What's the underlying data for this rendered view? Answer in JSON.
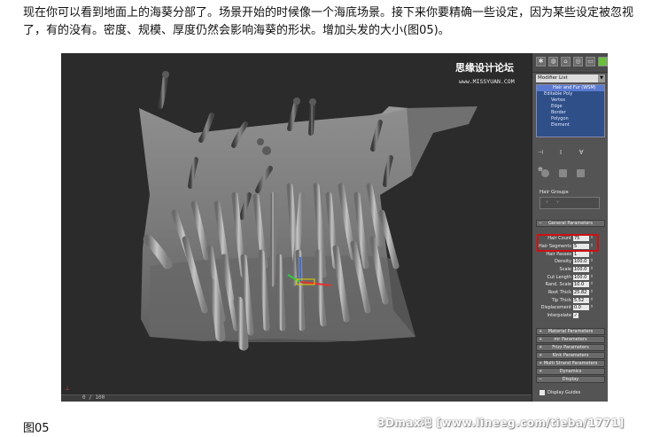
{
  "article": {
    "intro": "现在你可以看到地面上的海葵分部了。场景开始的时候像一个海底场景。接下来你要精确一些设定，因为某些设定被忽视了，有的没有。密度、规模、厚度仍然会影响海葵的形状。增加头发的大小(图05)。",
    "caption": "图05",
    "watermark_bottom": "3Dmax吧  [www.lineeg.com/tieba/1771]"
  },
  "screenshot": {
    "watermark_top": "思缘设计论坛",
    "watermark_top_url": "www.MISSYUAN.COM",
    "timebar_frame": "0 / 100",
    "modifier_list_label": "Modifier List",
    "modifier_stack": {
      "top": "Hair and Fur (WSM)",
      "base": "Editable Poly",
      "subobjects": [
        "Vertex",
        "Edge",
        "Border",
        "Polygon",
        "Element"
      ]
    },
    "hair_groups_label": "Hair Groups",
    "rollouts_top": [
      "General Parameters"
    ],
    "general_parameters": [
      {
        "label": "Hair Count",
        "value": "75"
      },
      {
        "label": "Hair Segments",
        "value": "5"
      },
      {
        "label": "Hair Passes",
        "value": "1"
      },
      {
        "label": "Density",
        "value": "100.0"
      },
      {
        "label": "Scale",
        "value": "100.0"
      },
      {
        "label": "Cut Length",
        "value": "100.0"
      },
      {
        "label": "Rand. Scale",
        "value": "10.0"
      },
      {
        "label": "Root Thick",
        "value": "25.82"
      },
      {
        "label": "Tip Thick",
        "value": "5.52"
      },
      {
        "label": "Displacement",
        "value": "0.0"
      }
    ],
    "interpolate_label": "Interpolate",
    "rollouts_bottom": [
      "Material Parameters",
      "mr Parameters",
      "Frizz Parameters",
      "Kink Parameters",
      "Multi Strand Parameters",
      "Dynamics",
      "Display"
    ],
    "display_guides_label": "Display Guides",
    "colors": {
      "highlight": "#d01010",
      "stack_bg": "#2f4f88",
      "viewport_bg": "#2b2b2b"
    }
  }
}
